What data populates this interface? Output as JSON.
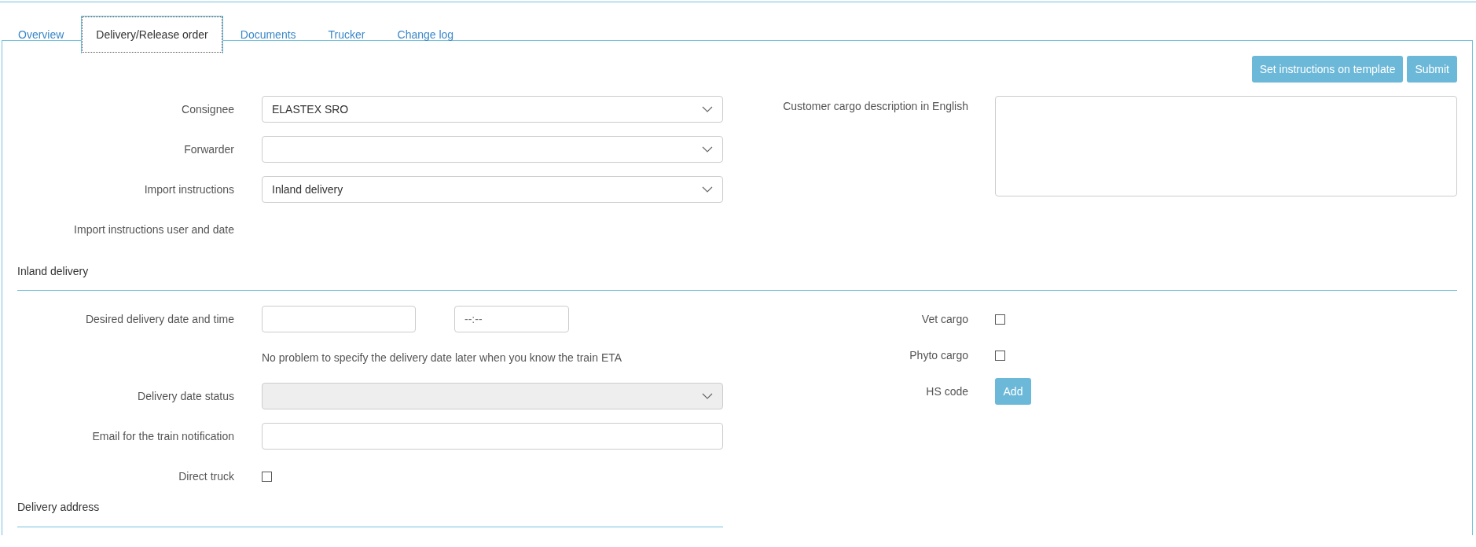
{
  "tabs": [
    {
      "label": "Overview",
      "selected": false
    },
    {
      "label": "Delivery/Release order",
      "selected": true
    },
    {
      "label": "Documents",
      "selected": false
    },
    {
      "label": "Trucker",
      "selected": false
    },
    {
      "label": "Change log",
      "selected": false
    }
  ],
  "actions": [
    "Set instructions on template",
    "Submit"
  ],
  "general": {
    "fields": [
      {
        "kind": "select",
        "label": "Consignee",
        "value": "ELASTEX SRO",
        "disabled": false
      },
      {
        "kind": "select",
        "label": "Forwarder",
        "disabled": false
      },
      {
        "kind": "select",
        "label": "Import instructions",
        "value": "Inland delivery",
        "disabled": false
      },
      {
        "kind": "text",
        "label": "Import instructions user and date"
      }
    ],
    "description": {
      "label": "Customer cargo description in English"
    }
  },
  "inland_delivery": {
    "title": "Inland delivery",
    "fields": [
      {
        "kind": "datetime",
        "label": "Desired delivery date and time",
        "time_placeholder": "--:--"
      },
      {
        "kind": "note",
        "text": "No problem to specify the delivery date later when you know the train ETA"
      },
      {
        "kind": "select",
        "label": "Delivery date status",
        "disabled": true
      },
      {
        "kind": "input",
        "label": "Email for the train notification"
      },
      {
        "kind": "checkbox",
        "label": "Direct truck",
        "checked": false
      }
    ],
    "cargo": [
      {
        "kind": "checkbox",
        "label": "Vet cargo",
        "checked": false
      },
      {
        "kind": "checkbox",
        "label": "Phyto cargo",
        "checked": false
      },
      {
        "kind": "button",
        "label": "HS code",
        "button": "Add"
      }
    ]
  },
  "delivery_address": {
    "title": "Delivery address"
  }
}
